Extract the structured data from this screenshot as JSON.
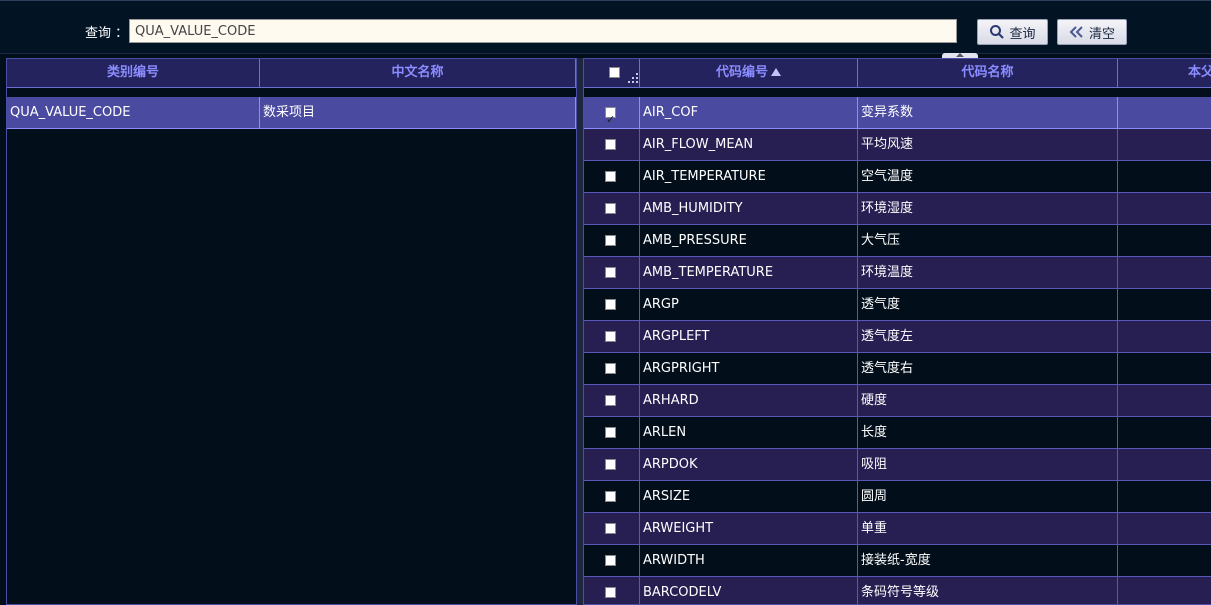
{
  "search": {
    "label": "查询 ：",
    "value": "QUA_VALUE_CODE",
    "search_button": "查询",
    "clear_button": "清空"
  },
  "left_grid": {
    "headers": [
      "类别编号",
      "中文名称"
    ],
    "rows": [
      {
        "code": "QUA_VALUE_CODE",
        "name": "数采项目",
        "selected": true
      }
    ]
  },
  "right_grid": {
    "headers": [
      "代码编号",
      "代码名称",
      "本父"
    ],
    "sort_column": "代码编号",
    "rows": [
      {
        "code": "AIR_COF",
        "name": "变异系数",
        "checked": true,
        "selected": true
      },
      {
        "code": "AIR_FLOW_MEAN",
        "name": "平均风速",
        "checked": false
      },
      {
        "code": "AIR_TEMPERATURE",
        "name": "空气温度",
        "checked": false
      },
      {
        "code": "AMB_HUMIDITY",
        "name": "环境湿度",
        "checked": false
      },
      {
        "code": "AMB_PRESSURE",
        "name": "大气压",
        "checked": false
      },
      {
        "code": "AMB_TEMPERATURE",
        "name": "环境温度",
        "checked": false
      },
      {
        "code": "ARGP",
        "name": "透气度",
        "checked": false
      },
      {
        "code": "ARGPLEFT",
        "name": "透气度左",
        "checked": false
      },
      {
        "code": "ARGPRIGHT",
        "name": "透气度右",
        "checked": false
      },
      {
        "code": "ARHARD",
        "name": "硬度",
        "checked": false
      },
      {
        "code": "ARLEN",
        "name": "长度",
        "checked": false
      },
      {
        "code": "ARPDOK",
        "name": "吸阻",
        "checked": false
      },
      {
        "code": "ARSIZE",
        "name": "圆周",
        "checked": false
      },
      {
        "code": "ARWEIGHT",
        "name": "单重",
        "checked": false
      },
      {
        "code": "ARWIDTH",
        "name": "接装纸-宽度",
        "checked": false
      },
      {
        "code": "BARCODELV",
        "name": "条码符号等级",
        "checked": false
      }
    ]
  },
  "colors": {
    "background": "#020f1b",
    "header_bg": "#25235e",
    "header_text": "#8a8cff",
    "odd_row": "#271e52",
    "selected_row": "#4a4aa0",
    "grid_line": "#5659b8"
  }
}
